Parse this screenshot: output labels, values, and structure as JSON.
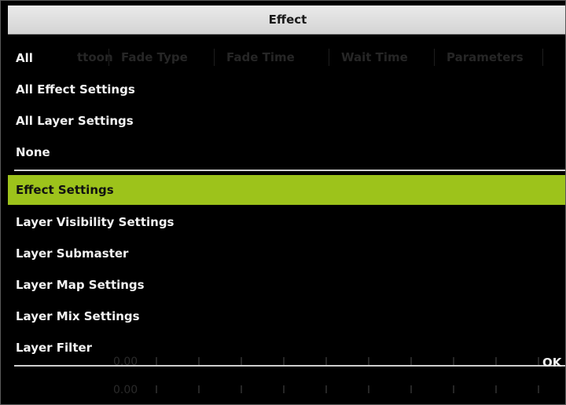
{
  "dialog": {
    "title": "Effect"
  },
  "background_table": {
    "headers": [
      "ttoon",
      "Fade Type",
      "Fade Time",
      "Wait Time",
      "Parameters"
    ],
    "row_labels": [
      "0.00",
      "0.00"
    ]
  },
  "menu": {
    "group1": [
      {
        "label": "All"
      },
      {
        "label": "All Effect Settings"
      },
      {
        "label": "All Layer Settings"
      },
      {
        "label": "None"
      }
    ],
    "group2": [
      {
        "label": "Effect Settings",
        "selected": true
      },
      {
        "label": "Layer Visibility Settings"
      },
      {
        "label": "Layer Submaster"
      },
      {
        "label": "Layer Map Settings"
      },
      {
        "label": "Layer Mix Settings"
      },
      {
        "label": "Layer Filter"
      }
    ]
  },
  "footer": {
    "ok_label": "OK"
  },
  "colors": {
    "selected_bg": "#9dc31b",
    "menu_bg": "#000000",
    "text": "#f2f2f2"
  }
}
